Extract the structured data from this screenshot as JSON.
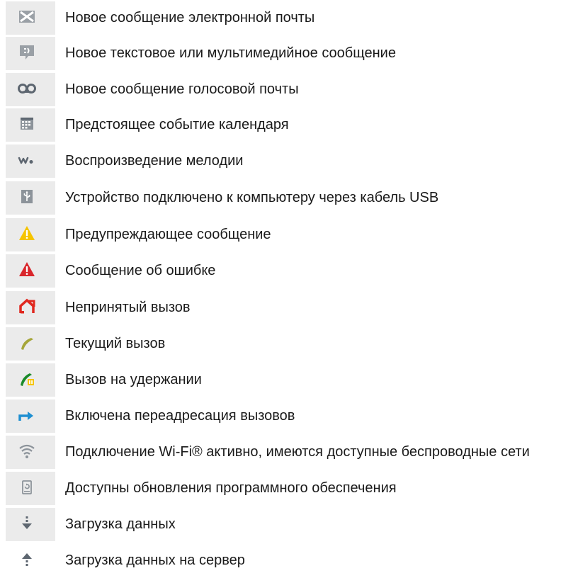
{
  "notifications": [
    {
      "icon": "email-icon",
      "label": "Новое сообщение электронной почты"
    },
    {
      "icon": "sms-mms-icon",
      "label": "Новое текстовое или мультимедийное сообщение"
    },
    {
      "icon": "voicemail-icon",
      "label": "Новое сообщение голосовой почты"
    },
    {
      "icon": "calendar-icon",
      "label": "Предстоящее событие календаря"
    },
    {
      "icon": "walkman-icon",
      "label": "Воспроизведение мелодии"
    },
    {
      "icon": "usb-icon",
      "label": "Устройство подключено к компьютеру через кабель USB"
    },
    {
      "icon": "warning-icon",
      "label": "Предупреждающее сообщение"
    },
    {
      "icon": "error-icon",
      "label": "Сообщение об ошибке"
    },
    {
      "icon": "missed-call-icon",
      "label": "Непринятый вызов"
    },
    {
      "icon": "ongoing-call-icon",
      "label": "Текущий вызов"
    },
    {
      "icon": "call-on-hold-icon",
      "label": "Вызов на удержании"
    },
    {
      "icon": "call-forwarding-icon",
      "label": "Включена переадресация вызовов"
    },
    {
      "icon": "wifi-icon",
      "label": "Подключение Wi-Fi® активно, имеются доступные беспроводные сети"
    },
    {
      "icon": "software-update-icon",
      "label": "Доступны обновления программного обеспечения"
    },
    {
      "icon": "download-icon",
      "label": "Загрузка данных"
    },
    {
      "icon": "upload-icon",
      "label": "Загрузка данных на сервер"
    }
  ],
  "colors": {
    "icon_cell_bg": "#ebebeb",
    "icon_gray": "#9aa0a6",
    "warning_yellow": "#f5c400",
    "error_red": "#d9262b",
    "missed_red": "#e0281f",
    "call_green": "#a6a63a",
    "hold_green": "#1a8a2a",
    "forward_blue": "#1e8fd1",
    "text": "#1a1a1a"
  }
}
